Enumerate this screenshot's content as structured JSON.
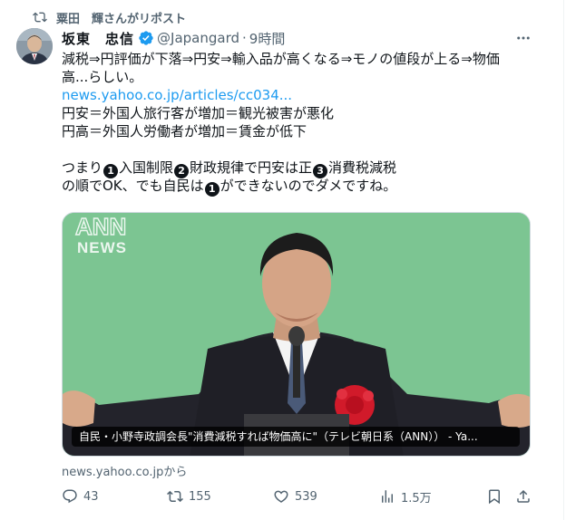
{
  "repost": {
    "text": "粟田　輝さんがリポスト",
    "icon": "repost-icon"
  },
  "author": {
    "name": "坂東　忠信",
    "handle": "@Japangard",
    "separator": "·",
    "time": "9時間",
    "verified_color": "#1d9bf0"
  },
  "tweet": {
    "lines": [
      "減税⇒円評価が下落⇒円安⇒輸入品が高くなる⇒モノの値段が上る⇒物価",
      "高...らしい。"
    ],
    "link": "news.yahoo.co.jp/articles/cc034...",
    "lines2": [
      "円安＝外国人旅行客が増加＝観光被害が悪化",
      "円高＝外国人労働者が増加＝賃金が低下"
    ],
    "summary": {
      "intro": "つまり",
      "n1": "1",
      "item1": "入国制限",
      "n2": "2",
      "item2": "財政規律で円安は正",
      "n3": "3",
      "item3": "消費税減税",
      "l2a": "の順でOK、でも自民は",
      "n4": "1",
      "l2b": "ができないのでダメですね。"
    }
  },
  "media": {
    "logo_top": "ANN",
    "logo_bottom": "NEWS",
    "caption": "自民・小野寺政調会長\"消費減税すれば物価高に\"（テレビ朝日系（ANN））  - Ya..."
  },
  "source": "news.yahoo.co.jpから",
  "actions": {
    "reply": "43",
    "repost": "155",
    "like": "539",
    "views": "1.5万"
  },
  "colors": {
    "accent": "#1d9bf0",
    "muted": "#536471",
    "text": "#0f1419"
  }
}
